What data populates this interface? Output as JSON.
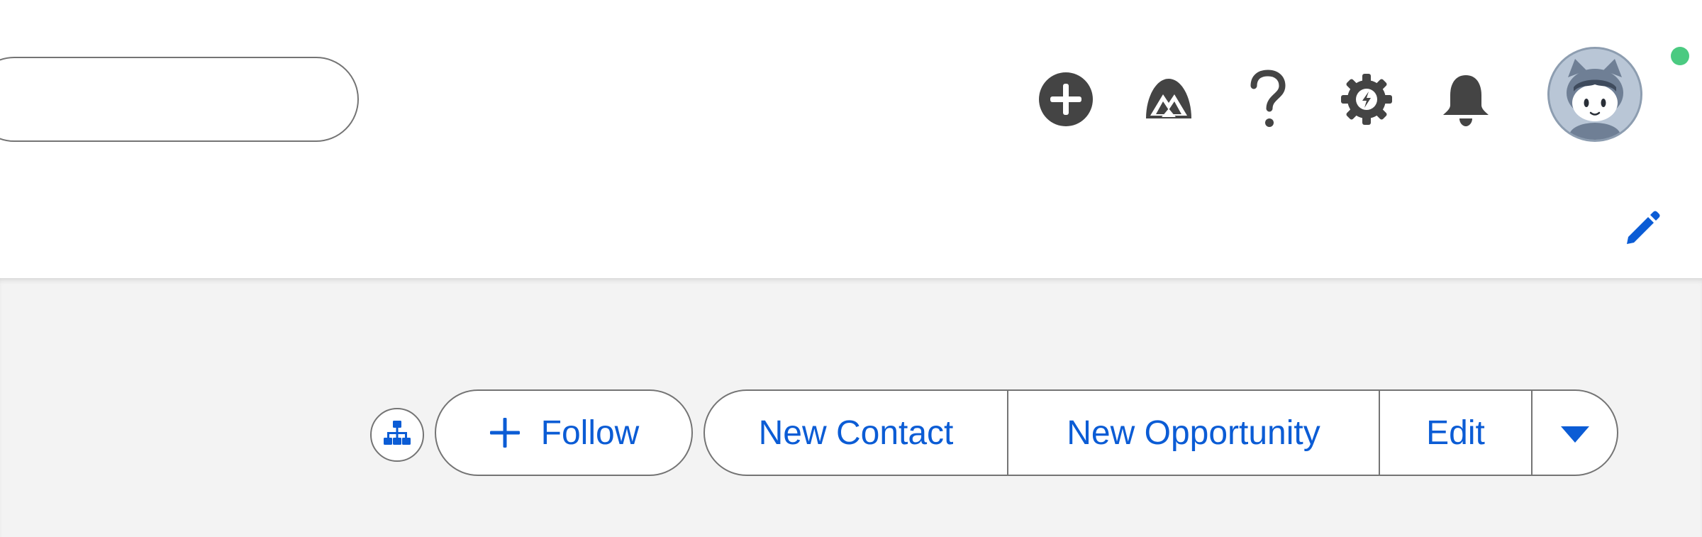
{
  "header": {
    "search": {
      "placeholder": ""
    },
    "utility_icons": [
      {
        "name": "global-actions-add",
        "icon": "plus-circle-icon"
      },
      {
        "name": "trailhead-guidance",
        "icon": "mountain-icon"
      },
      {
        "name": "help",
        "icon": "question-mark-icon"
      },
      {
        "name": "setup",
        "icon": "gear-icon"
      },
      {
        "name": "notifications",
        "icon": "bell-icon"
      }
    ],
    "avatar": {
      "icon": "astro-avatar-icon",
      "presence": "online",
      "presence_color": "#4bca81"
    }
  },
  "nav": {
    "edit_icon": "pencil-icon"
  },
  "record_actions": {
    "hierarchy_icon": "hierarchy-icon",
    "follow_label": "Follow",
    "follow_icon": "plus-icon",
    "buttons": [
      {
        "label": "New Contact"
      },
      {
        "label": "New Opportunity"
      },
      {
        "label": "Edit"
      }
    ],
    "more_icon": "caret-down-icon"
  },
  "colors": {
    "accent": "#0b5cd5",
    "icon": "#444444",
    "border": "#747474",
    "band_background": "#f3f3f3"
  }
}
